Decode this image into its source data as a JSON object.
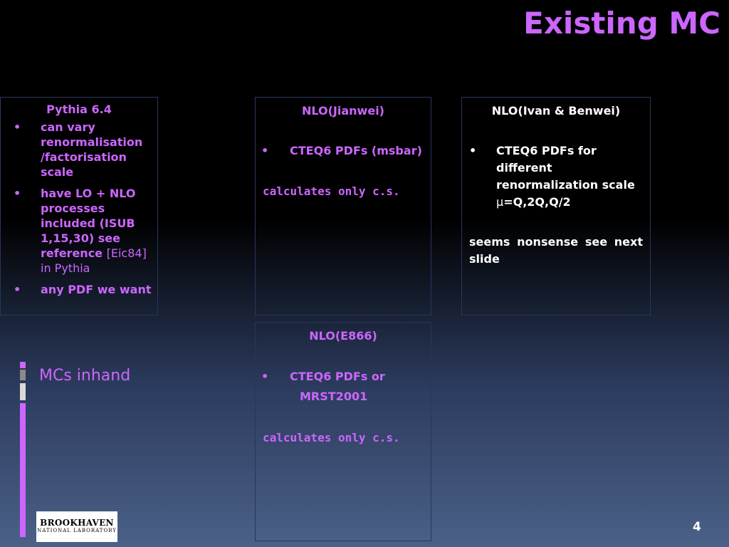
{
  "title": "Existing MC",
  "pythia": {
    "header": "Pythia 6.4",
    "bullets": [
      {
        "text": "can vary renormalisation /factorisation scale"
      },
      {
        "text": "have LO + NLO processes included (ISUB 1,15,30) see reference",
        "suffix": "[Eic84] in Pythia"
      },
      {
        "text": "any PDF we want"
      }
    ]
  },
  "jianwei": {
    "header": "NLO(Jianwei)",
    "bullet": "CTEQ6 PDFs (msbar)",
    "paragraph": "calculates only c.s."
  },
  "ivan": {
    "header": "NLO(Ivan & Benwei)",
    "bullet_main": "CTEQ6 PDFs for different renormalization scale",
    "bullet_mu": "μ",
    "bullet_tail": "=Q,2Q,Q/2",
    "paragraph": "seems nonsense see next slide"
  },
  "e866": {
    "header": "NLO(E866)",
    "bullet": "CTEQ6 PDFs or",
    "sub": "MRST2001",
    "paragraph": "calculates only c.s."
  },
  "bullet_glyph": "•",
  "mcs_label": "MCs inhand",
  "logo": {
    "line1": "BROOKHAVEN",
    "line2": "NATIONAL LABORATORY"
  },
  "page_number": "4",
  "colors": {
    "accent": "#cc66ff",
    "text_white": "#ffffff",
    "box_border": "#27375c"
  }
}
